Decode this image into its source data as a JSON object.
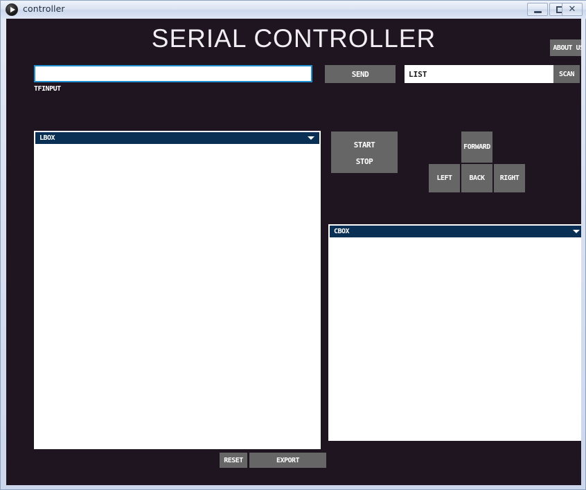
{
  "window": {
    "title": "controller",
    "icon": "play-circle-icon",
    "controls": {
      "minimize": "minimize",
      "maximize": "maximize",
      "close": "✕"
    }
  },
  "theme": {
    "background": "#1e1521",
    "panel_header": "#0a2f55",
    "button": "#666666",
    "accent_border": "#1e90d0",
    "text": "#ffffff"
  },
  "header": {
    "title": "SERIAL CONTROLLER",
    "about_label": "ABOUT US"
  },
  "input_row": {
    "tf_input_value": "",
    "tf_input_placeholder": "",
    "tf_input_label": "TFINPUT",
    "send_label": "SEND",
    "list_value": "LIST",
    "list_placeholder": "",
    "scan_label": "SCAN"
  },
  "lbox": {
    "header_label": "LBOX",
    "items": []
  },
  "cbox": {
    "header_label": "CBOX",
    "items": []
  },
  "control_panel": {
    "start_label": "START",
    "stop_label": "STOP"
  },
  "dpad": {
    "forward_label": "FORWARD",
    "left_label": "LEFT",
    "back_label": "BACK",
    "right_label": "RIGHT"
  },
  "footer": {
    "reset_label": "RESET",
    "export_label": "EXPORT"
  }
}
